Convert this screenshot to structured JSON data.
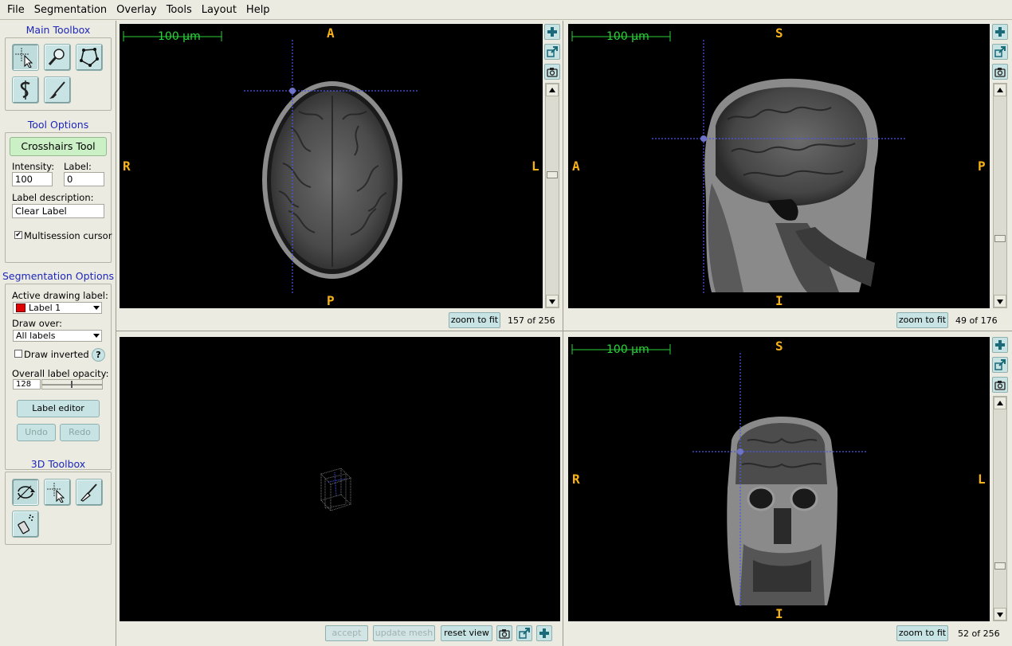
{
  "menu": [
    "File",
    "Segmentation",
    "Overlay",
    "Tools",
    "Layout",
    "Help"
  ],
  "main_toolbox": {
    "title": "Main Toolbox",
    "tools": [
      "crosshairs-icon",
      "zoom-icon",
      "polygon-icon",
      "snake-icon",
      "paintbrush-icon"
    ]
  },
  "tool_options": {
    "title": "Tool Options",
    "active_tool": "Crosshairs Tool",
    "intensity_label": "Intensity:",
    "intensity_value": "100",
    "label_label": "Label:",
    "label_value": "0",
    "label_description_label": "Label description:",
    "label_description_value": "Clear Label",
    "multisession_label": "Multisession cursor",
    "multisession_checked": true
  },
  "segmentation_options": {
    "title": "Segmentation Options",
    "active_label_label": "Active drawing label:",
    "active_label_value": "Label 1",
    "active_label_color": "#e00000",
    "draw_over_label": "Draw over:",
    "draw_over_value": "All labels",
    "draw_inverted_label": "Draw inverted",
    "help_glyph": "?",
    "opacity_label": "Overall label opacity:",
    "opacity_value": "128",
    "label_editor": "Label editor",
    "undo": "Undo",
    "redo": "Redo"
  },
  "toolbox_3d": {
    "title": "3D Toolbox",
    "tools": [
      "rotate-icon",
      "crosshairs-3d-icon",
      "scalpel-icon",
      "spraypaint-icon"
    ]
  },
  "views": {
    "axial": {
      "top": "A",
      "bottom": "P",
      "left": "R",
      "right": "L",
      "scale": "100 µm",
      "zoom_btn": "zoom to fit",
      "slice": "157 of 256"
    },
    "sagittal": {
      "top": "S",
      "bottom": "I",
      "left": "A",
      "right": "P",
      "scale": "100 µm",
      "zoom_btn": "zoom to fit",
      "slice": "49 of 176"
    },
    "coronal": {
      "top": "S",
      "bottom": "I",
      "left": "R",
      "right": "L",
      "scale": "100 µm",
      "zoom_btn": "zoom to fit",
      "slice": "52 of 256"
    },
    "render3d": {
      "accept": "accept",
      "update_mesh": "update mesh",
      "reset_view": "reset view"
    }
  },
  "colors": {
    "orientation": "#f7b218",
    "scalebar": "#2ad23a",
    "crosshair": "#4a56e8",
    "toolbox_title": "#1d27b8"
  }
}
